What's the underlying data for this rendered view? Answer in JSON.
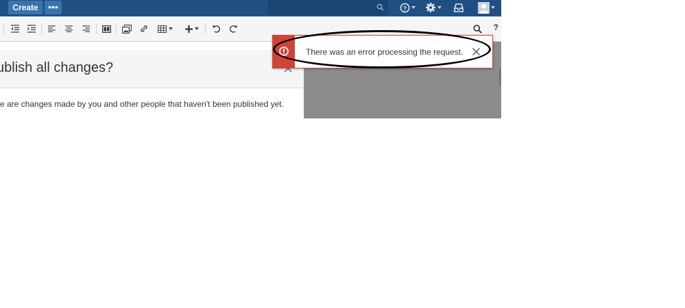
{
  "topnav": {
    "create_label": "Create",
    "more_label": "•••",
    "icons": [
      "search-icon",
      "help-icon",
      "gear-icon",
      "notifications-icon",
      "user-avatar-icon"
    ]
  },
  "toolbar": {
    "icons": [
      "indent-decrease-icon",
      "indent-increase-icon",
      "align-left-icon",
      "align-center-icon",
      "align-right-icon",
      "page-layout-icon",
      "insert-image-icon",
      "insert-link-icon",
      "insert-table-icon",
      "insert-more-icon",
      "undo-icon",
      "redo-icon",
      "find-icon"
    ],
    "help_label": "?"
  },
  "dialog": {
    "title": "ublish all changes?",
    "body": "re are changes made by you and other people that haven't been published yet."
  },
  "flag": {
    "message": "There was an error processing the request.",
    "color": "#d04437"
  },
  "colors": {
    "nav": "#205081",
    "button": "#3b73af",
    "error": "#d04437"
  }
}
